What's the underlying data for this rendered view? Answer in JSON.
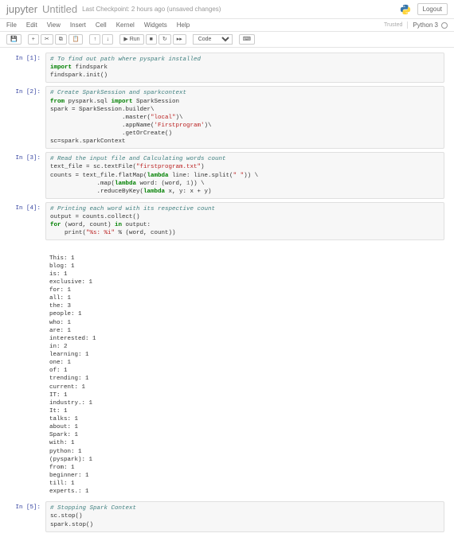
{
  "header": {
    "logo": "jupyter",
    "title": "Untitled",
    "checkpoint": "Last Checkpoint: 2 hours ago  (unsaved changes)",
    "logout": "Logout"
  },
  "menubar": {
    "items": [
      "File",
      "Edit",
      "View",
      "Insert",
      "Cell",
      "Kernel",
      "Widgets",
      "Help"
    ],
    "trusted": "Trusted",
    "kernel": "Python 3"
  },
  "toolbar": {
    "save_icon": "save-icon",
    "add_icon": "plus-icon",
    "cut_icon": "cut-icon",
    "copy_icon": "copy-icon",
    "paste_icon": "paste-icon",
    "up_icon": "arrow-up-icon",
    "down_icon": "arrow-down-icon",
    "run_label": "▶ Run",
    "stop_icon": "stop-icon",
    "restart_icon": "restart-icon",
    "ff_icon": "fast-forward-icon",
    "celltype": "Code",
    "keyboard_icon": "keyboard-icon"
  },
  "cells": [
    {
      "prompt": "In [1]:",
      "lines": [
        {
          "t": "comment",
          "s": "# To find out path where pyspark installed"
        },
        {
          "t": "code",
          "s": "<k>import</k> findspark"
        },
        {
          "t": "code",
          "s": "findspark.init()"
        }
      ]
    },
    {
      "prompt": "In [2]:",
      "lines": [
        {
          "t": "comment",
          "s": "# Create SparkSession and sparkcontext"
        },
        {
          "t": "code",
          "s": "<k>from</k> pyspark.sql <k>import</k> SparkSession"
        },
        {
          "t": "code",
          "s": "spark = SparkSession.builder\\"
        },
        {
          "t": "code",
          "s": "                    .master(<str>\"local\"</str>)\\"
        },
        {
          "t": "code",
          "s": "                    .appName(<str>'Firstprogram'</str>)\\"
        },
        {
          "t": "code",
          "s": "                    .getOrCreate()"
        },
        {
          "t": "code",
          "s": "sc=spark.sparkContext"
        }
      ]
    },
    {
      "prompt": "In [3]:",
      "lines": [
        {
          "t": "comment",
          "s": "# Read the input file and Calculating words count"
        },
        {
          "t": "code",
          "s": "text_file = sc.textFile(<str>\"firstprogram.txt\"</str>)"
        },
        {
          "t": "code",
          "s": "counts = text_file.flatMap(<k>lambda</k> line: line.split(<str>\" \"</str>)) \\"
        },
        {
          "t": "code",
          "s": "             .map(<k>lambda</k> word: (word, <n>1</n>)) \\"
        },
        {
          "t": "code",
          "s": "             .reduceByKey(<k>lambda</k> x, y: x + y)"
        }
      ]
    },
    {
      "prompt": "In [4]:",
      "lines": [
        {
          "t": "comment",
          "s": "# Printing each word with its respective count"
        },
        {
          "t": "code",
          "s": "output = counts.collect()"
        },
        {
          "t": "code",
          "s": "<k>for</k> (word, count) <k>in</k> output:"
        },
        {
          "t": "code",
          "s": "    print(<str>\"%s: %i\"</str> % (word, count))"
        }
      ],
      "output": [
        "This: 1",
        "blog: 1",
        "is: 1",
        "exclusive: 1",
        "for: 1",
        "all: 1",
        "the: 3",
        "people: 1",
        "who: 1",
        "are: 1",
        "interested: 1",
        "in: 2",
        "learning: 1",
        "one: 1",
        "of: 1",
        "trending: 1",
        "current: 1",
        "IT: 1",
        "industry.: 1",
        "It: 1",
        "talks: 1",
        "about: 1",
        "Spark: 1",
        "with: 1",
        "python: 1",
        "(pyspark): 1",
        "from: 1",
        "beginner: 1",
        "till: 1",
        "experts.: 1"
      ]
    },
    {
      "prompt": "In [5]:",
      "lines": [
        {
          "t": "comment",
          "s": "# Stopping Spark Context"
        },
        {
          "t": "code",
          "s": "sc.stop()"
        },
        {
          "t": "code",
          "s": "spark.stop()"
        }
      ]
    }
  ]
}
